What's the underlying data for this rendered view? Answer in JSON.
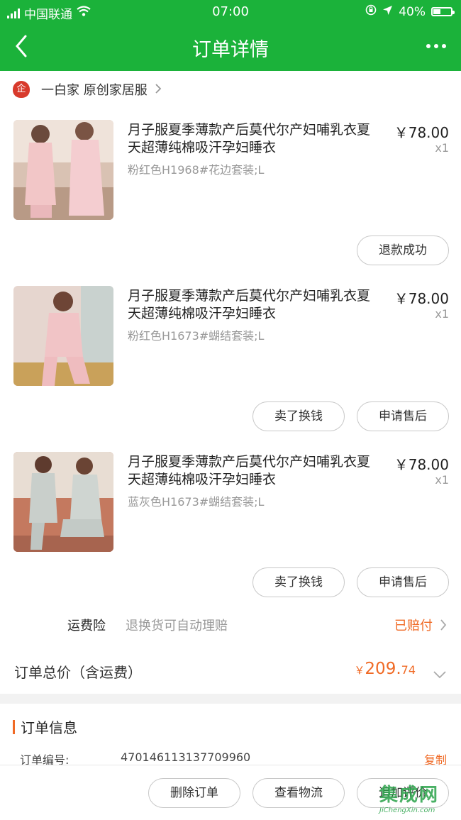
{
  "status_bar": {
    "carrier": "中国联通",
    "time": "07:00",
    "battery": "40%"
  },
  "navbar": {
    "back_icon": "chevron-left-icon",
    "title": "订单详情",
    "more_icon": "more-dots-icon"
  },
  "shop": {
    "logo_text": "企",
    "name": "一白家 原创家居服"
  },
  "items": [
    {
      "title": "月子服夏季薄款产后莫代尔产妇哺乳衣夏天超薄纯棉吸汗孕妇睡衣",
      "spec": "粉红色H1968#花边套装;L",
      "price": "￥78.00",
      "qty": "x1",
      "buttons": [
        "退款成功"
      ]
    },
    {
      "title": "月子服夏季薄款产后莫代尔产妇哺乳衣夏天超薄纯棉吸汗孕妇睡衣",
      "spec": "粉红色H1673#蝴结套装;L",
      "price": "￥78.00",
      "qty": "x1",
      "buttons": [
        "卖了换钱",
        "申请售后"
      ]
    },
    {
      "title": "月子服夏季薄款产后莫代尔产妇哺乳衣夏天超薄纯棉吸汗孕妇睡衣",
      "spec": "蓝灰色H1673#蝴结套装;L",
      "price": "￥78.00",
      "qty": "x1",
      "buttons": [
        "卖了换钱",
        "申请售后"
      ]
    }
  ],
  "insurance": {
    "label": "运费险",
    "desc": "退换货可自动理赔",
    "status": "已赔付"
  },
  "total": {
    "label": "订单总价（含运费）",
    "currency": "￥",
    "integer": "209.",
    "decimal": "74"
  },
  "order_info": {
    "heading": "订单信息",
    "number_label": "订单编号:",
    "number_value": "470146113137709960",
    "copy_label": "复制"
  },
  "bottom_actions": [
    "删除订单",
    "查看物流",
    "追加评价"
  ],
  "watermark": {
    "text": "集成网",
    "url_text": "JiChengXin.com"
  },
  "colors": {
    "brand_green": "#1bb23a",
    "accent_orange": "#f06a25"
  }
}
